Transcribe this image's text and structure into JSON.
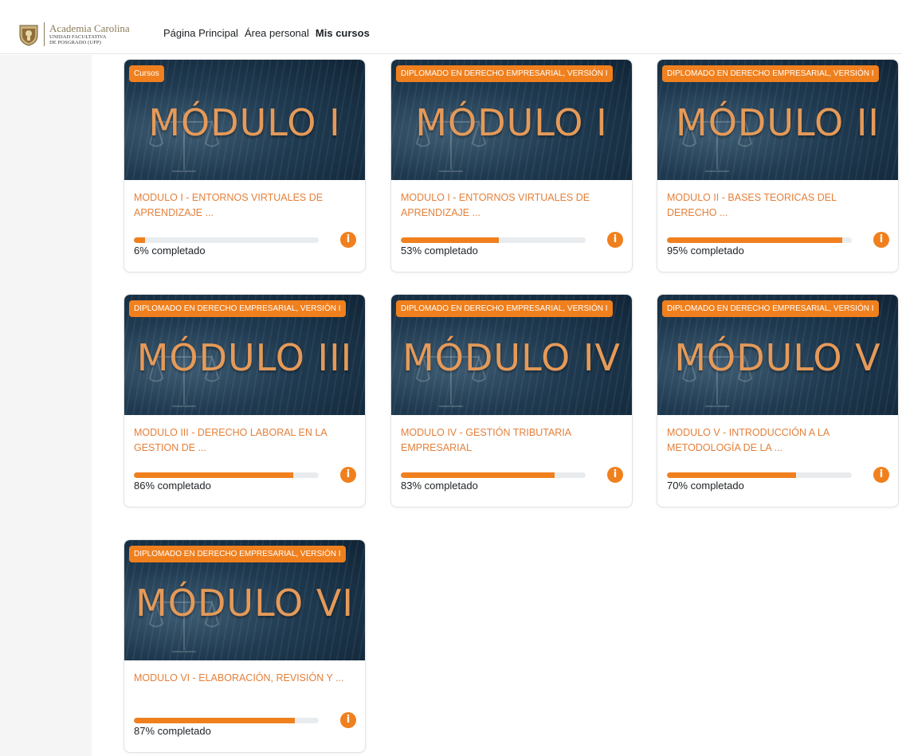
{
  "header": {
    "brand_name": "Academia Carolina",
    "brand_sub_1": "UNIDAD FACULTATIVA",
    "brand_sub_2": "DE POSGRADO (UFP)",
    "nav": [
      {
        "label": "Página Principal",
        "active": false
      },
      {
        "label": "Área personal",
        "active": false
      },
      {
        "label": "Mis cursos",
        "active": true
      }
    ]
  },
  "accent_color": "#f0801e",
  "info_glyph": "i",
  "courses": [
    {
      "category": "Cursos",
      "banner_title": "MÓDULO I",
      "name": "MODULO I - ENTORNOS VIRTUALES DE APRENDIZAJE ...",
      "progress": 6,
      "progress_text": "6% completado"
    },
    {
      "category": "DIPLOMADO EN DERECHO EMPRESARIAL, VERSIÓN I",
      "banner_title": "MÓDULO I",
      "name": "MODULO I - ENTORNOS VIRTUALES DE APRENDIZAJE ...",
      "progress": 53,
      "progress_text": "53% completado"
    },
    {
      "category": "DIPLOMADO EN DERECHO EMPRESARIAL, VERSIÓN I",
      "banner_title": "MÓDULO II",
      "name": "MODULO II - BASES TEORICAS DEL DERECHO ...",
      "progress": 95,
      "progress_text": "95% completado"
    },
    {
      "category": "DIPLOMADO EN DERECHO EMPRESARIAL, VERSIÓN I",
      "banner_title": "MÓDULO III",
      "name": "MODULO III - DERECHO LABORAL EN LA GESTION DE ...",
      "progress": 86,
      "progress_text": "86% completado"
    },
    {
      "category": "DIPLOMADO EN DERECHO EMPRESARIAL, VERSIÓN I",
      "banner_title": "MÓDULO IV",
      "name": "MODULO IV - GESTIÓN TRIBUTARIA EMPRESARIAL",
      "progress": 83,
      "progress_text": "83% completado"
    },
    {
      "category": "DIPLOMADO EN DERECHO EMPRESARIAL, VERSIÓN I",
      "banner_title": "MÓDULO V",
      "name": "MODULO V - INTRODUCCIÓN A LA METODOLOGÍA DE LA ...",
      "progress": 70,
      "progress_text": "70% completado"
    },
    {
      "category": "DIPLOMADO EN DERECHO EMPRESARIAL, VERSIÓN I",
      "banner_title": "MÓDULO VI",
      "name": "MODULO VI - ELABORACIÓN, REVISIÓN Y ...",
      "progress": 87,
      "progress_text": "87% completado"
    }
  ]
}
